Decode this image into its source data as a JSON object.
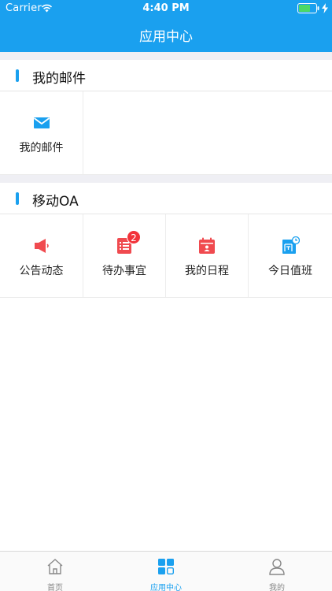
{
  "status_bar": {
    "carrier": "Carrier",
    "time": "4:40 PM"
  },
  "nav": {
    "title": "应用中心"
  },
  "colors": {
    "accent": "#1aa0ef",
    "mail": "#1aa0ef",
    "red": "#f04a4f",
    "badge": "#f2333a"
  },
  "sections": [
    {
      "title": "我的邮件",
      "items": [
        {
          "label": "我的邮件",
          "icon": "envelope-icon"
        }
      ]
    },
    {
      "title": "移动OA",
      "items": [
        {
          "label": "公告动态",
          "icon": "megaphone-icon"
        },
        {
          "label": "待办事宜",
          "icon": "todo-list-icon",
          "badge": "2"
        },
        {
          "label": "我的日程",
          "icon": "calendar-icon"
        },
        {
          "label": "今日值班",
          "icon": "duty-icon"
        }
      ]
    }
  ],
  "tabbar": {
    "tabs": [
      {
        "label": "首页",
        "icon": "home-icon",
        "active": false
      },
      {
        "label": "应用中心",
        "icon": "apps-grid-icon",
        "active": true
      },
      {
        "label": "我的",
        "icon": "user-icon",
        "active": false
      }
    ]
  }
}
